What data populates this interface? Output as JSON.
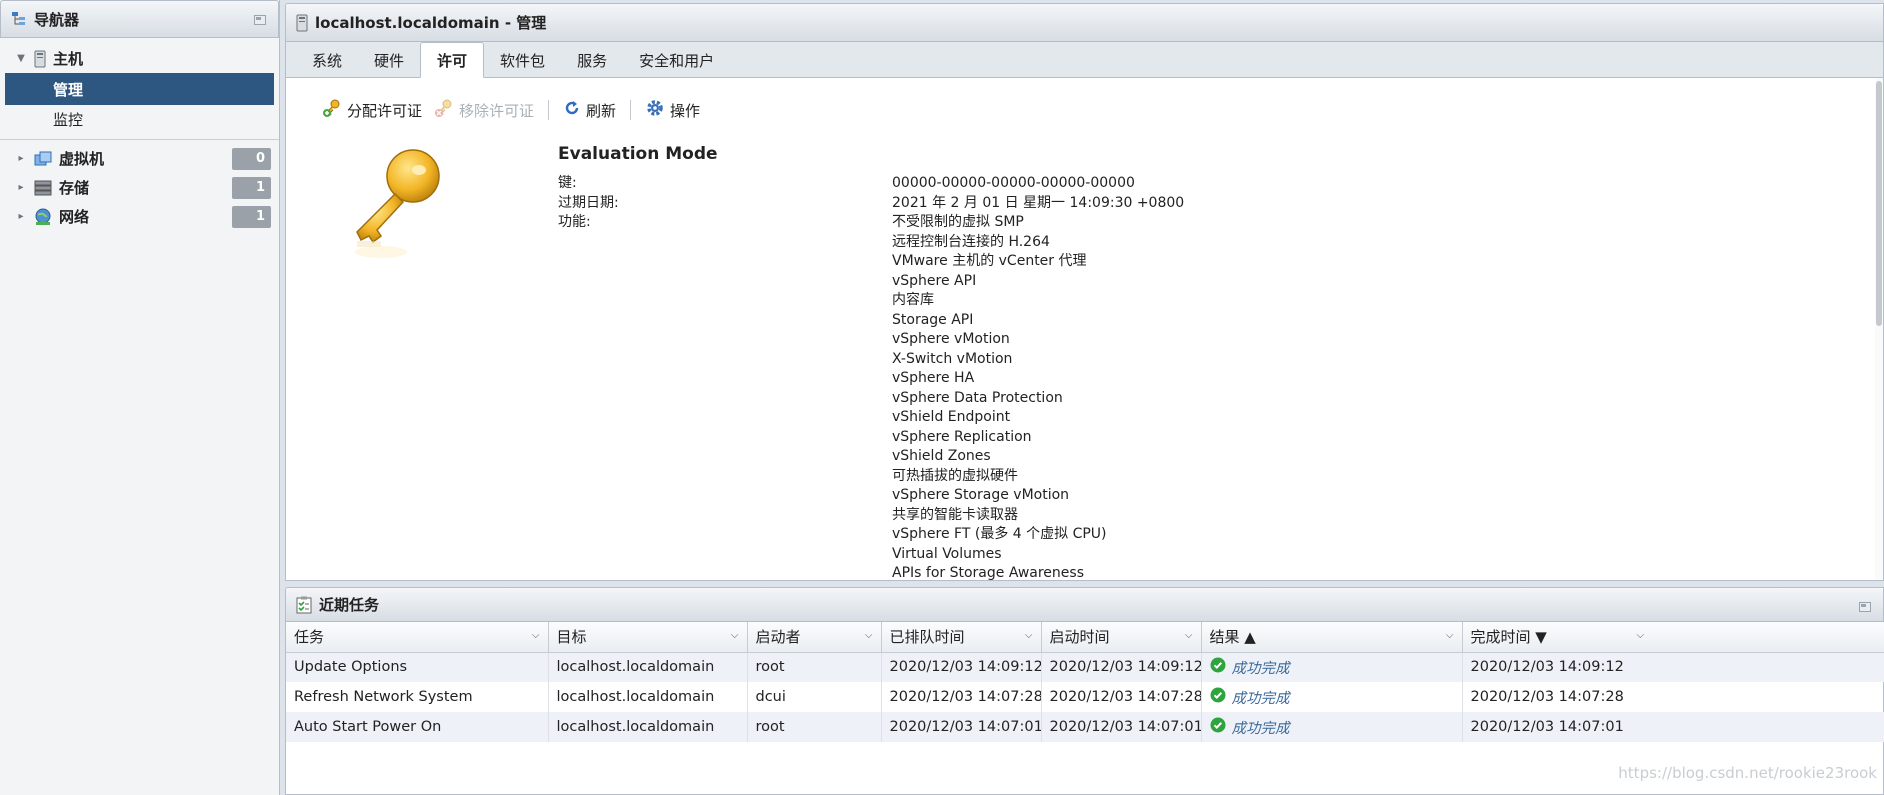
{
  "navigator": {
    "title": "导航器",
    "host": {
      "label": "主机",
      "children": [
        {
          "label": "管理"
        },
        {
          "label": "监控"
        }
      ]
    },
    "groups": [
      {
        "label": "虚拟机",
        "count": "0"
      },
      {
        "label": "存储",
        "count": "1"
      },
      {
        "label": "网络",
        "count": "1"
      }
    ]
  },
  "main": {
    "title": "localhost.localdomain - 管理",
    "tabs": [
      {
        "label": "系统"
      },
      {
        "label": "硬件"
      },
      {
        "label": "许可"
      },
      {
        "label": "软件包"
      },
      {
        "label": "服务"
      },
      {
        "label": "安全和用户"
      }
    ],
    "toolbar": {
      "assign": "分配许可证",
      "remove": "移除许可证",
      "refresh": "刷新",
      "actions": "操作"
    },
    "license": {
      "title": "Evaluation Mode",
      "key_label": "键:",
      "key_value": "00000-00000-00000-00000-00000",
      "expiry_label": "过期日期:",
      "expiry_value": "2021 年 2 月 01 日 星期一 14:09:30 +0800",
      "features_label": "功能:",
      "features": [
        "不受限制的虚拟 SMP",
        "远程控制台连接的 H.264",
        "VMware 主机的 vCenter 代理",
        "vSphere API",
        "内容库",
        "Storage API",
        "vSphere vMotion",
        "X-Switch vMotion",
        "vSphere HA",
        "vSphere Data Protection",
        "vShield Endpoint",
        "vSphere Replication",
        "vShield Zones",
        "可热插拔的虚拟硬件",
        "vSphere Storage vMotion",
        "共享的智能卡读取器",
        "vSphere FT (最多 4 个虚拟 CPU)",
        "Virtual Volumes",
        "APIs for Storage Awareness"
      ]
    }
  },
  "tasks": {
    "title": "近期任务",
    "columns": [
      "任务",
      "目标",
      "启动者",
      "已排队时间",
      "启动时间",
      "结果 ▲",
      "完成时间 ▼"
    ],
    "rows": [
      [
        "Update Options",
        "localhost.localdomain",
        "root",
        "2020/12/03 14:09:12",
        "2020/12/03 14:09:12",
        "成功完成",
        "2020/12/03 14:09:12"
      ],
      [
        "Refresh Network System",
        "localhost.localdomain",
        "dcui",
        "2020/12/03 14:07:28",
        "2020/12/03 14:07:28",
        "成功完成",
        "2020/12/03 14:07:28"
      ],
      [
        "Auto Start Power On",
        "localhost.localdomain",
        "root",
        "2020/12/03 14:07:01",
        "2020/12/03 14:07:01",
        "成功完成",
        "2020/12/03 14:07:01"
      ]
    ]
  },
  "watermark": "https://blog.csdn.net/rookie23rook",
  "colors": {
    "selected": "#2d5680",
    "success": "#2ea43f",
    "link": "#3b6a9a"
  }
}
